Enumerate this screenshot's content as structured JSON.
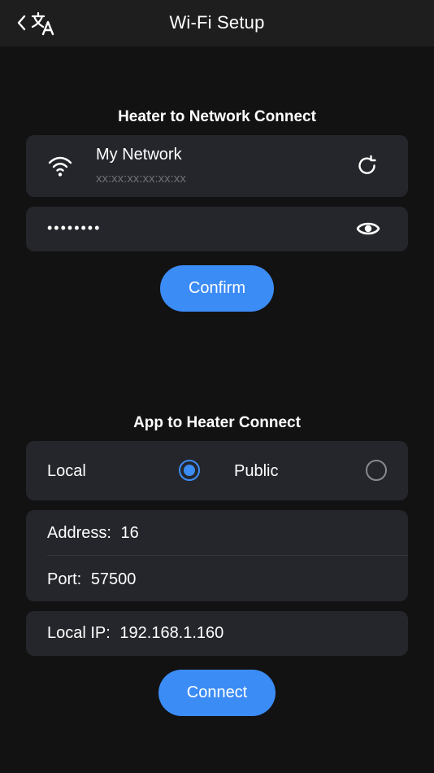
{
  "header": {
    "title": "Wi-Fi Setup"
  },
  "network_section": {
    "title": "Heater to Network Connect",
    "network_name": "My Network",
    "network_mac": "xx:xx:xx:xx:xx:xx",
    "password_masked": "••••••••",
    "confirm_label": "Confirm"
  },
  "app_section": {
    "title": "App to Heater Connect",
    "mode_local_label": "Local",
    "mode_public_label": "Public",
    "selected_mode": "Local",
    "address_label": "Address:",
    "address_value": "16",
    "port_label": "Port:",
    "port_value": "57500",
    "local_ip_label": "Local IP:",
    "local_ip_value": "192.168.1.160",
    "connect_label": "Connect"
  },
  "colors": {
    "accent": "#3c8cf6",
    "background": "#121212",
    "card": "#24262b",
    "header": "#1e1e1e"
  }
}
